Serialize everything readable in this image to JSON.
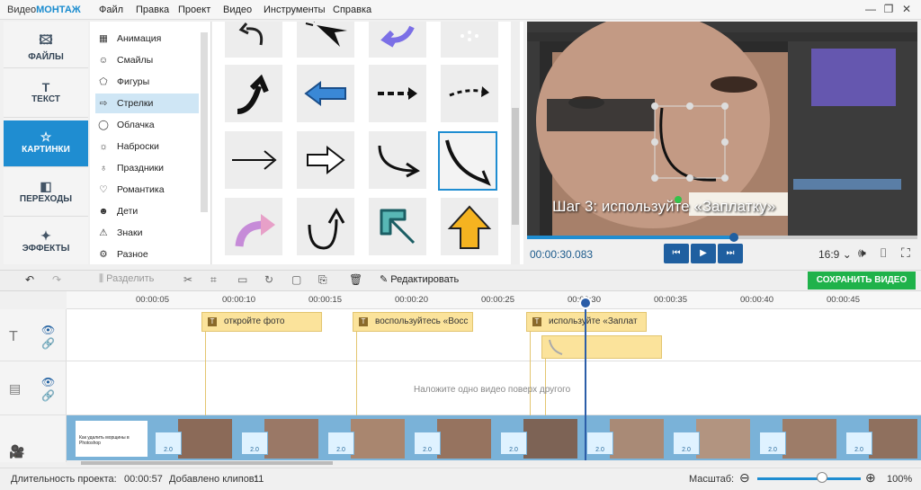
{
  "app": {
    "logo_a": "Видео",
    "logo_b": "МОНТАЖ",
    "menu": [
      "Файл",
      "Правка",
      "Проект",
      "Видео",
      "Инструменты",
      "Справка"
    ]
  },
  "nav": [
    {
      "label": "ФАЙЛЫ",
      "icon": "image-icon"
    },
    {
      "label": "ТЕКСТ",
      "icon": "text-icon"
    },
    {
      "label": "КАРТИНКИ",
      "icon": "star-icon"
    },
    {
      "label": "ПЕРЕХОДЫ",
      "icon": "transitions-icon"
    },
    {
      "label": "ЭФФЕКТЫ",
      "icon": "effects-icon"
    }
  ],
  "categories": [
    {
      "label": "Анимация",
      "icon": "film-icon"
    },
    {
      "label": "Смайлы",
      "icon": "smiley-icon"
    },
    {
      "label": "Фигуры",
      "icon": "shapes-icon"
    },
    {
      "label": "Стрелки",
      "icon": "arrow-icon"
    },
    {
      "label": "Облачка",
      "icon": "bubble-icon"
    },
    {
      "label": "Наброски",
      "icon": "sketch-icon"
    },
    {
      "label": "Праздники",
      "icon": "holiday-icon"
    },
    {
      "label": "Романтика",
      "icon": "heart-icon"
    },
    {
      "label": "Дети",
      "icon": "kids-icon"
    },
    {
      "label": "Знаки",
      "icon": "sign-icon"
    },
    {
      "label": "Разное",
      "icon": "misc-icon"
    }
  ],
  "preview": {
    "caption": "Шаг 3: используйте «Заплатку»",
    "time": "00:00:30.083",
    "ratio": "16:9",
    "progress": 0.53
  },
  "toolbar": {
    "split": "Разделить",
    "edit": "Редактировать",
    "save": "СОХРАНИТЬ ВИДЕО"
  },
  "ruler": [
    "00:00:05",
    "00:00:10",
    "00:00:15",
    "00:00:20",
    "00:00:25",
    "00:00:30",
    "00:00:35",
    "00:00:40",
    "00:00:45"
  ],
  "text_clips": [
    "откройте фото",
    "воспользуйтесь «Восс",
    "используйте «Заплат"
  ],
  "overlay_hint": "Наложите одно видео поверх другого",
  "first_clip_text": "Как удалить морщины в Photoshop",
  "transition_label": "2.0",
  "status": {
    "duration_label": "Длительность проекта:",
    "duration": "00:00:57",
    "clips_label": "Добавлено клипов:",
    "clips": "11",
    "zoom_label": "Масштаб:",
    "zoom": "100%"
  },
  "colors": {
    "accent": "#1f8dd1",
    "save": "#1fb24a",
    "clip": "#fbe39b"
  }
}
